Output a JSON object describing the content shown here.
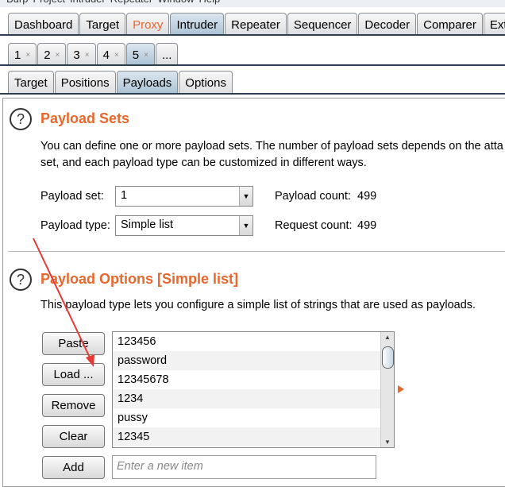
{
  "menu": [
    "Burp",
    "Project",
    "Intruder",
    "Repeater",
    "Window",
    "Help"
  ],
  "main_tabs": [
    {
      "label": "Dashboard"
    },
    {
      "label": "Target"
    },
    {
      "label": "Proxy",
      "color": "#e8672d"
    },
    {
      "label": "Intruder",
      "selected": true
    },
    {
      "label": "Repeater"
    },
    {
      "label": "Sequencer"
    },
    {
      "label": "Decoder"
    },
    {
      "label": "Comparer"
    },
    {
      "label": "Exte"
    }
  ],
  "attack_tabs": [
    {
      "label": "1"
    },
    {
      "label": "2"
    },
    {
      "label": "3"
    },
    {
      "label": "4"
    },
    {
      "label": "5",
      "selected": true
    },
    {
      "label": "..."
    }
  ],
  "close_glyph": "×",
  "sub_tabs": [
    {
      "label": "Target"
    },
    {
      "label": "Positions"
    },
    {
      "label": "Payloads",
      "selected": true
    },
    {
      "label": "Options"
    }
  ],
  "payload_sets": {
    "title": "Payload Sets",
    "desc1": "You can define one or more payload sets. The number of payload sets depends on the atta",
    "desc2": "set, and each payload type can be customized in different ways.",
    "set_label": "Payload set:",
    "set_value": "1",
    "type_label": "Payload type:",
    "type_value": "Simple list",
    "count_label": "Payload count:",
    "count_value": "499",
    "request_label": "Request count:",
    "request_value": "499"
  },
  "payload_options": {
    "title": "Payload Options [Simple list]",
    "desc": "This payload type lets you configure a simple list of strings that are used as payloads.",
    "buttons": {
      "paste": "Paste",
      "load": "Load ...",
      "remove": "Remove",
      "clear": "Clear",
      "add": "Add"
    },
    "items": [
      "123456",
      "password",
      "12345678",
      "1234",
      "pussy",
      "12345"
    ],
    "new_item_placeholder": "Enter a new item"
  },
  "help_glyph": "?",
  "accent": "#e8672d",
  "annotation_arrow_color": "#e53935"
}
